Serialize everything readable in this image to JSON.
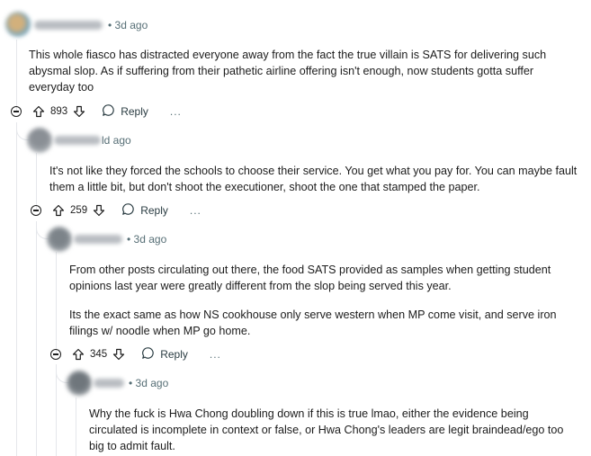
{
  "comments": [
    {
      "time": "3d ago",
      "paragraphs": [
        "This whole fiasco has distracted everyone away from the fact the true villain is SATS for delivering such abysmal slop. As if suffering from their pathetic airline offering isn't enough, now students gotta suffer everyday too"
      ],
      "votes": "893",
      "reply_label": "Reply",
      "more_label": "..."
    },
    {
      "time": "ld ago",
      "paragraphs": [
        "It's not like they forced the schools to choose their service. You get what you pay for. You can maybe fault them a little bit, but don't shoot the executioner, shoot the one that stamped the paper."
      ],
      "votes": "259",
      "reply_label": "Reply",
      "more_label": "..."
    },
    {
      "time": "3d ago",
      "paragraphs": [
        "From other posts circulating out there, the food SATS provided as samples when getting student opinions last year were greatly different from the slop being served this year.",
        "Its the exact same as how NS cookhouse only serve western when MP come visit, and serve iron filings w/ noodle when MP go home."
      ],
      "votes": "345",
      "reply_label": "Reply",
      "more_label": "..."
    },
    {
      "time": "3d ago",
      "paragraphs": [
        "Why the fuck is Hwa Chong doubling down if this is true lmao, either the evidence being circulated is incomplete in context or false, or Hwa Chong's leaders are legit braindead/ego too big to admit fault."
      ]
    }
  ]
}
